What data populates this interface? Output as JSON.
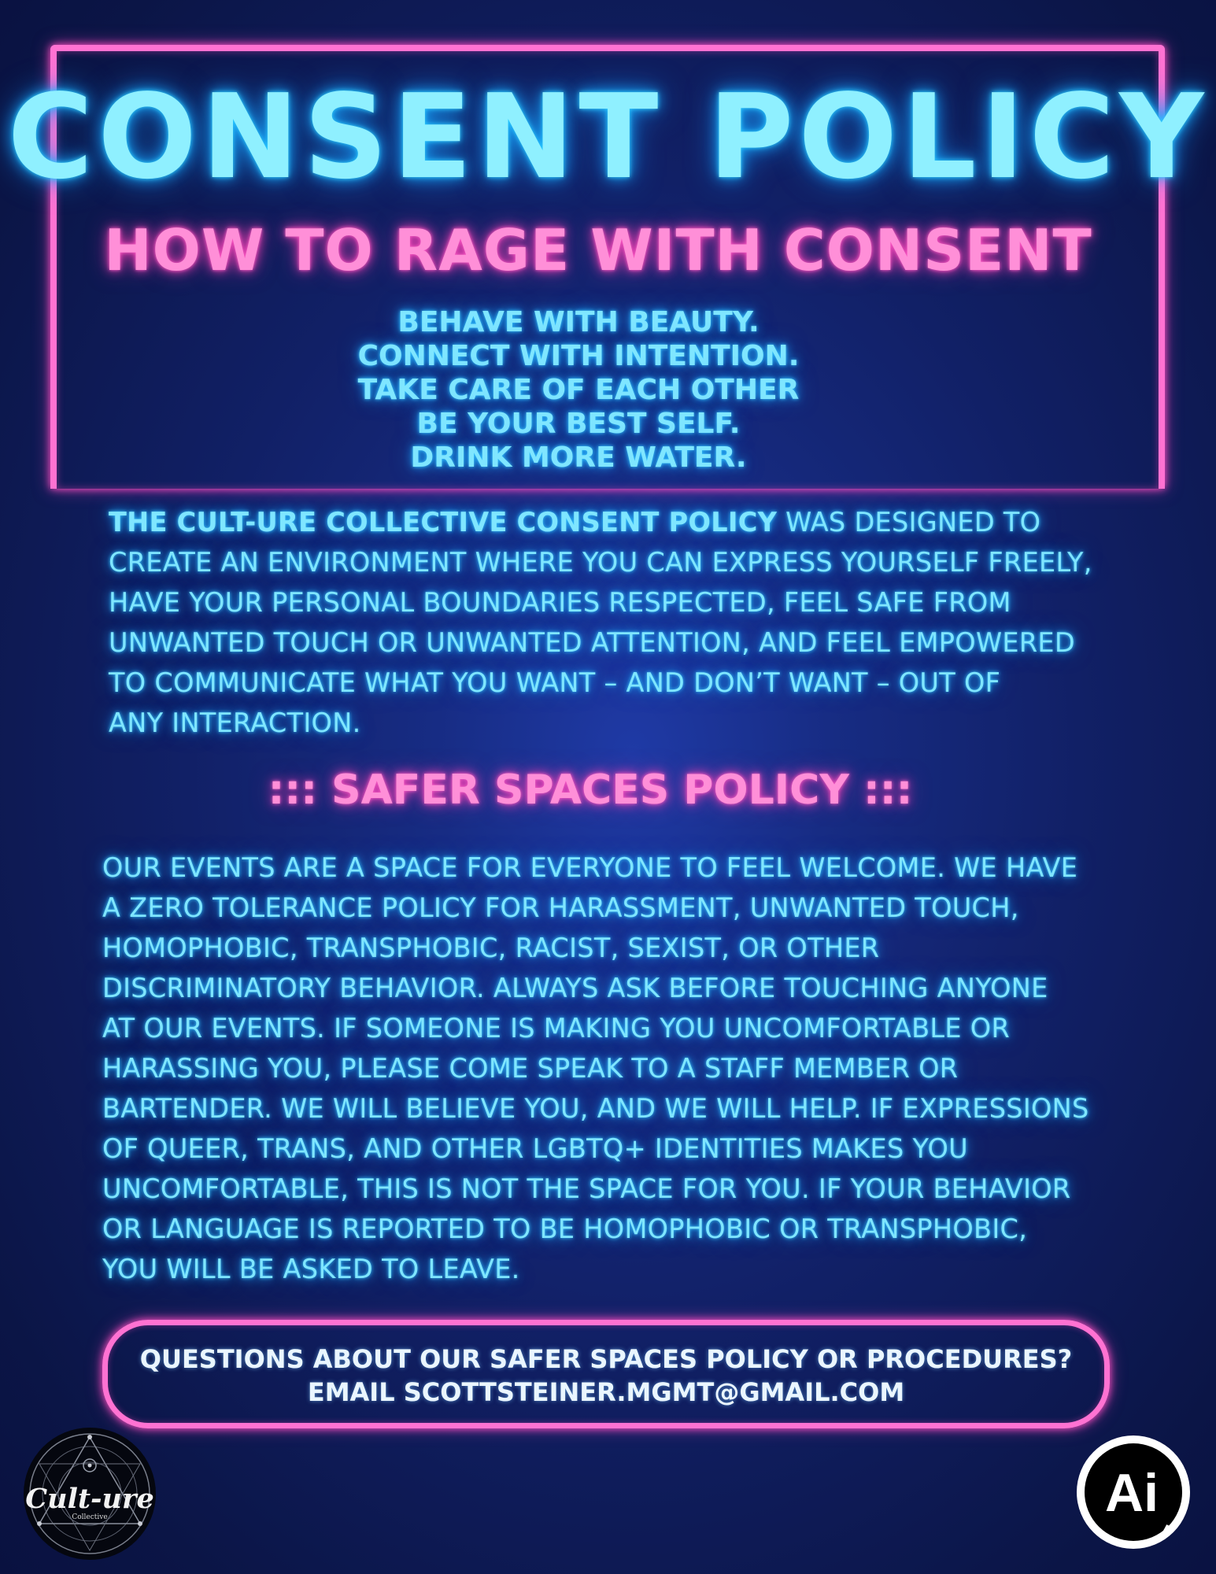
{
  "header": {
    "title": "CONSENT POLICY",
    "subtitle": "HOW TO RAGE WITH CONSENT"
  },
  "motto": [
    "BEHAVE WITH BEAUTY.",
    "CONNECT WITH INTENTION.",
    "TAKE CARE OF EACH OTHER",
    "BE YOUR BEST SELF.",
    "DRINK MORE WATER."
  ],
  "consent_policy": {
    "lead": "THE CULT-URE COLLECTIVE CONSENT POLICY",
    "lines": [
      " WAS DESIGNED TO",
      "CREATE AN ENVIRONMENT WHERE YOU CAN EXPRESS YOURSELF FREELY,",
      "HAVE YOUR PERSONAL BOUNDARIES RESPECTED, FEEL SAFE FROM",
      "UNWANTED TOUCH OR UNWANTED ATTENTION, AND FEEL EMPOWERED",
      "TO COMMUNICATE WHAT YOU WANT – AND DON’T WANT – OUT OF",
      "ANY INTERACTION."
    ]
  },
  "safer_spaces": {
    "heading": "::: SAFER SPACES POLICY :::",
    "lines": [
      "OUR EVENTS ARE A SPACE FOR EVERYONE TO FEEL WELCOME. WE HAVE",
      "A ZERO TOLERANCE POLICY FOR HARASSMENT, UNWANTED TOUCH,",
      "HOMOPHOBIC, TRANSPHOBIC, RACIST, SEXIST, OR OTHER",
      "DISCRIMINATORY BEHAVIOR. ALWAYS ASK BEFORE TOUCHING ANYONE",
      "AT OUR EVENTS. IF SOMEONE IS MAKING YOU UNCOMFORTABLE OR",
      "HARASSING YOU, PLEASE COME SPEAK TO A STAFF MEMBER OR",
      "BARTENDER. WE WILL BELIEVE YOU, AND WE WILL HELP. IF EXPRESSIONS",
      "OF QUEER, TRANS, AND OTHER LGBTQ+ IDENTITIES MAKES YOU",
      "UNCOMFORTABLE, THIS IS NOT THE SPACE FOR YOU. IF YOUR BEHAVIOR",
      "OR LANGUAGE IS REPORTED TO BE HOMOPHOBIC OR TRANSPHOBIC,",
      "YOU WILL BE ASKED TO LEAVE."
    ]
  },
  "contact": {
    "question": "QUESTIONS ABOUT OUR SAFER SPACES POLICY OR PROCEDURES?",
    "email_line": "EMAIL SCOTTSTEINER.MGMT@GMAIL.COM"
  },
  "logos": {
    "left": {
      "icon": "cult-ure-collective-logo-icon",
      "wordmark": "Cult-ure",
      "tagline": "Collective"
    },
    "right": {
      "icon": "ai-logo-icon",
      "wordmark": "Ai"
    }
  },
  "colors": {
    "background": "#112066",
    "neon_cyan": "#7fe6ff",
    "neon_pink": "#ff72d2"
  }
}
